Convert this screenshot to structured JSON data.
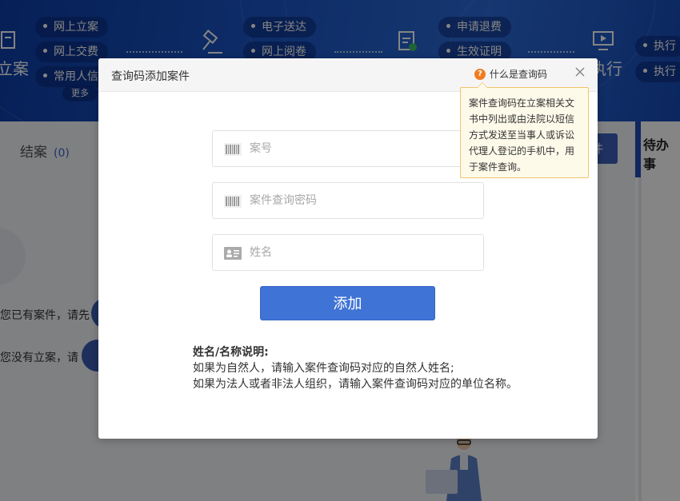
{
  "background": {
    "banner_items": {
      "col1": [
        "网上立案",
        "网上交费",
        "常用人信"
      ],
      "col2": [
        "电子送达",
        "网上阅卷"
      ],
      "col3": [
        "申请退费",
        "生效证明"
      ],
      "col4": [
        "执行",
        "执行"
      ]
    },
    "more_label": "更多",
    "label_lian": "立案",
    "label_zhixing": "执行",
    "tab_closed": "结案",
    "tab_closed_count": "(0)",
    "button_partial": "件",
    "right_title": "待办事",
    "text_line1": "您已有案件，请先",
    "text_line2": "您没有立案，请"
  },
  "modal": {
    "title": "查询码添加案件",
    "help_label": "什么是查询码",
    "tooltip": "案件查询码在立案相关文书中列出或由法院以短信方式发送至当事人或诉讼代理人登记的手机中，用于案件查询。",
    "fields": {
      "case_no_placeholder": "案号",
      "password_placeholder": "案件查询密码",
      "name_placeholder": "姓名"
    },
    "add_button": "添加",
    "note": {
      "heading": "姓名/名称说明:",
      "line1": "如果为自然人，请输入案件查询码对应的自然人姓名;",
      "line2": "如果为法人或者非法人组织，请输入案件查询码对应的单位名称。"
    }
  },
  "colors": {
    "primary_button": "#3f73d6",
    "help_icon": "#f07c1e",
    "tooltip_bg": "#fefaea",
    "tooltip_border": "#f3c36b"
  }
}
